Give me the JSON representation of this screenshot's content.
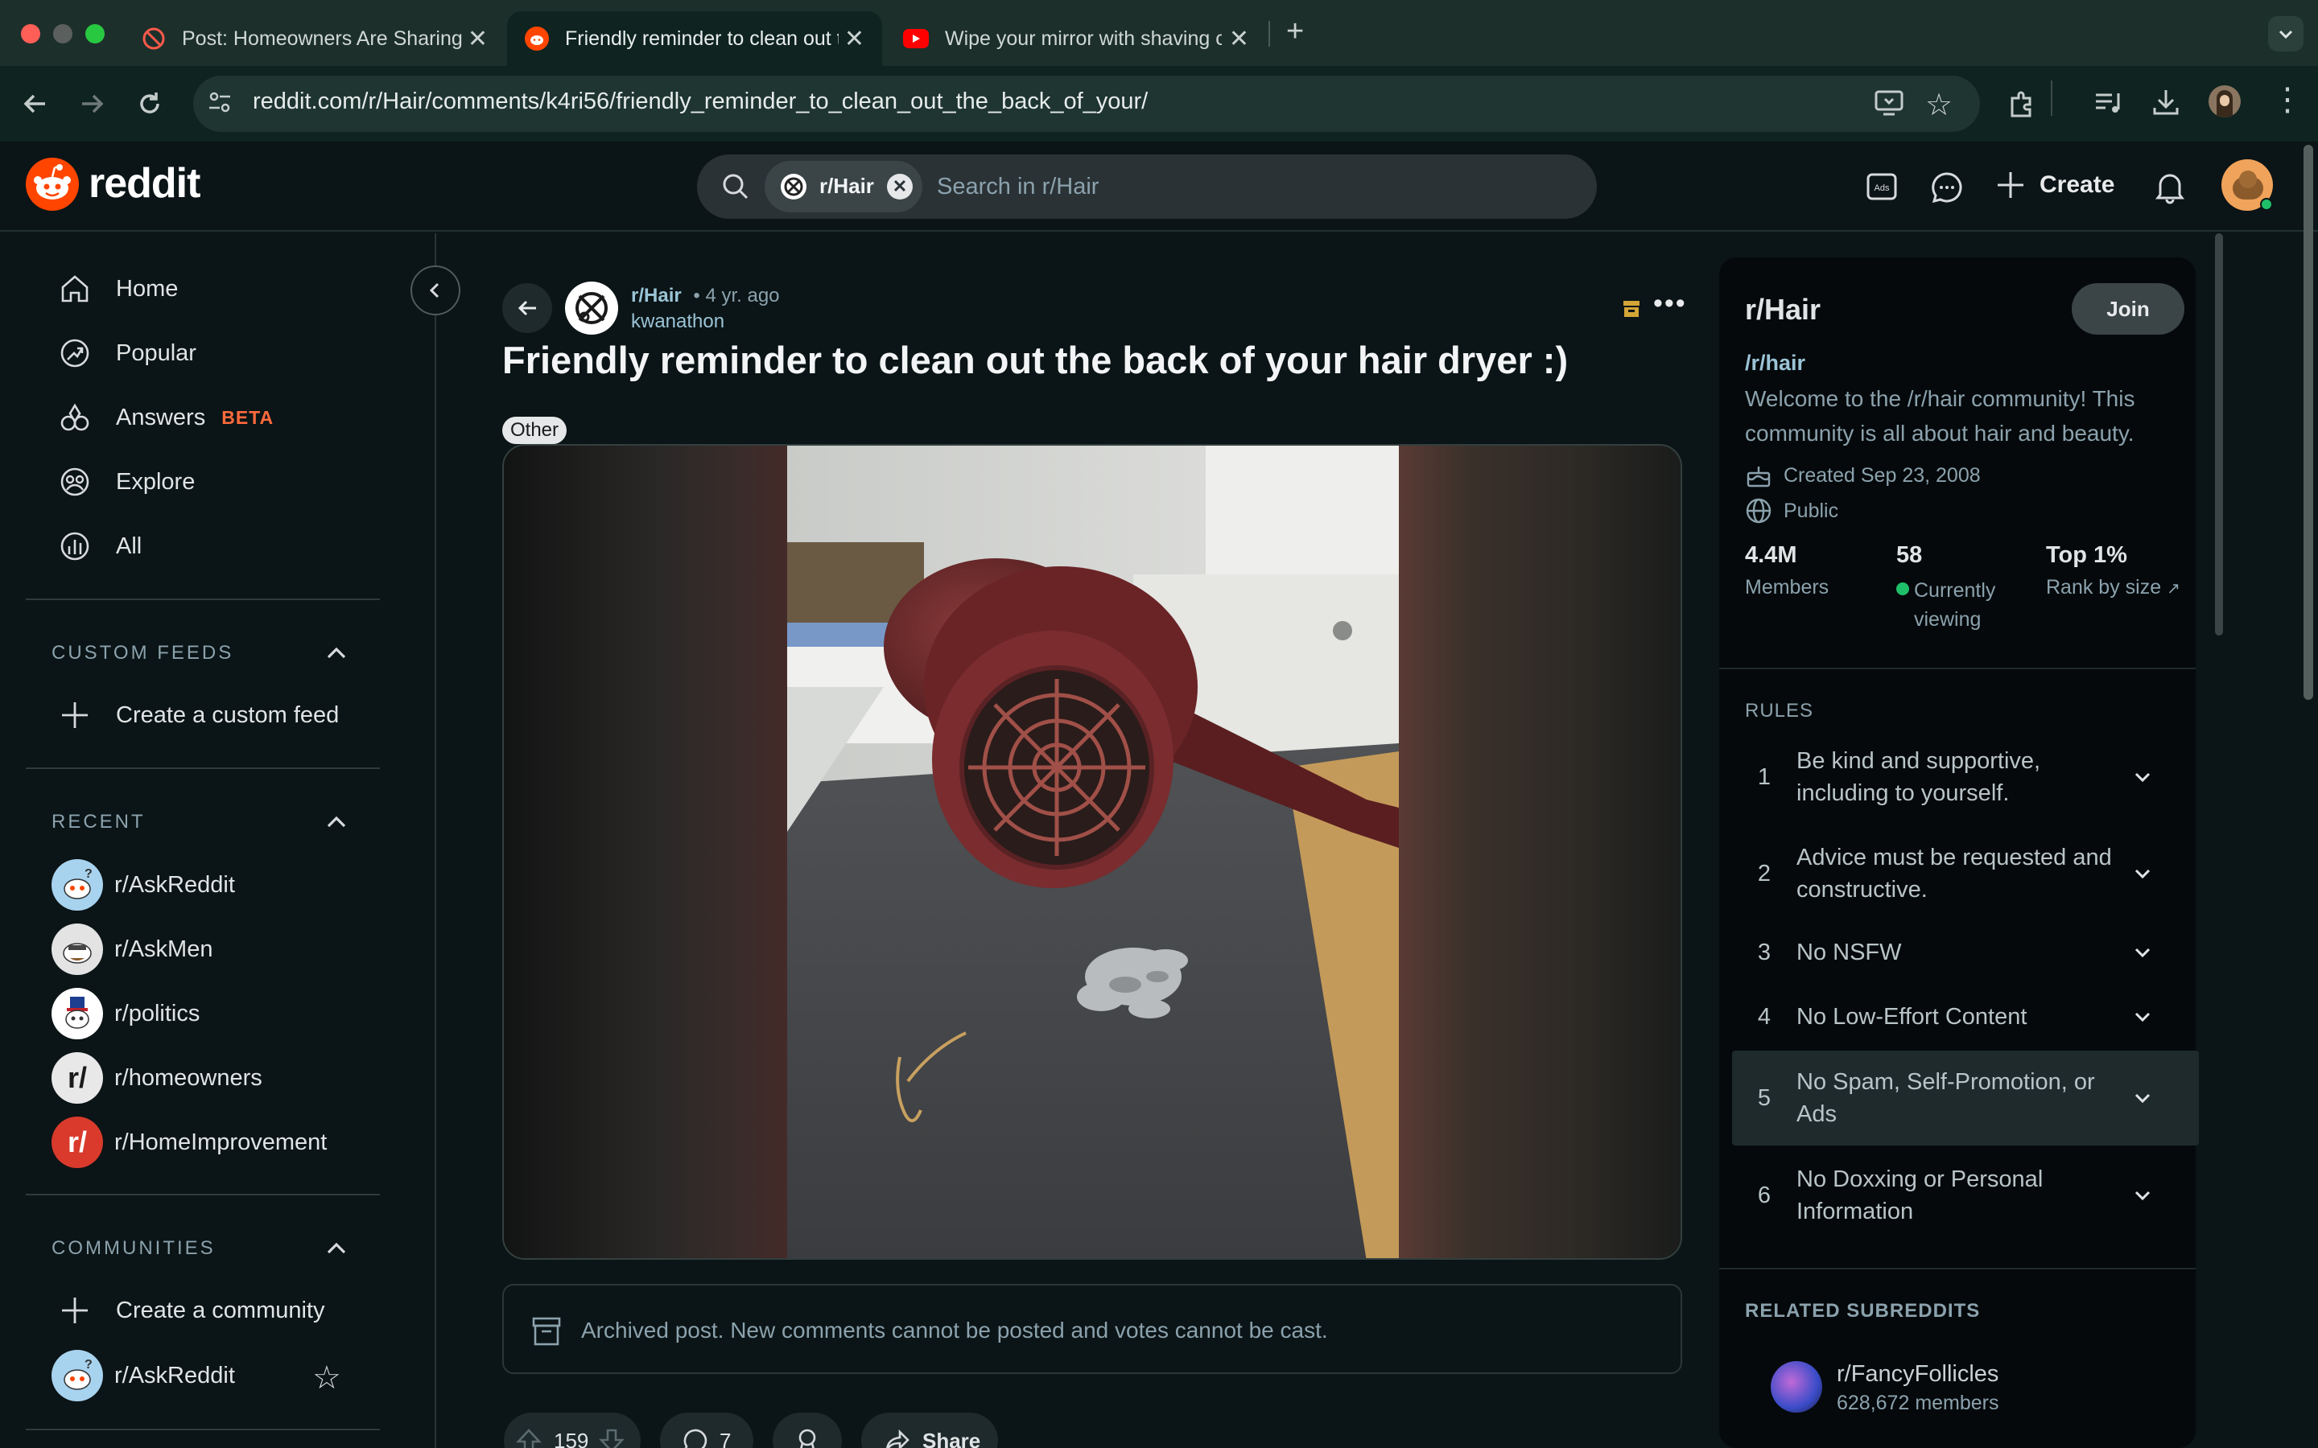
{
  "browser": {
    "tabs": [
      {
        "title": "Post: Homeowners Are Sharing",
        "icon": "blocked-icon"
      },
      {
        "title": "Friendly reminder to clean out the back of your hair dryer",
        "icon": "reddit-icon",
        "active": true
      },
      {
        "title": "Wipe your mirror with shaving cream",
        "icon": "youtube-icon"
      }
    ],
    "url": "reddit.com/r/Hair/comments/k4ri56/friendly_reminder_to_clean_out_the_back_of_your/"
  },
  "header": {
    "logo_text": "reddit",
    "search_chip": "r/Hair",
    "search_placeholder": "Search in r/Hair",
    "create_label": "Create"
  },
  "left_nav": {
    "main": [
      {
        "label": "Home",
        "icon": "home-icon"
      },
      {
        "label": "Popular",
        "icon": "popular-icon"
      },
      {
        "label": "Answers",
        "badge": "BETA",
        "icon": "answers-icon"
      },
      {
        "label": "Explore",
        "icon": "explore-icon"
      },
      {
        "label": "All",
        "icon": "all-icon"
      }
    ],
    "custom_feeds": {
      "heading": "CUSTOM FEEDS",
      "create": "Create a custom feed"
    },
    "recent": {
      "heading": "RECENT",
      "items": [
        "r/AskReddit",
        "r/AskMen",
        "r/politics",
        "r/homeowners",
        "r/HomeImprovement"
      ]
    },
    "communities": {
      "heading": "COMMUNITIES",
      "create": "Create a community",
      "items": [
        "r/AskReddit"
      ]
    }
  },
  "post": {
    "subreddit": "r/Hair",
    "age": "• 4 yr. ago",
    "author": "kwanathon",
    "title": "Friendly reminder to clean out the back of your hair dryer :)",
    "flair": "Other",
    "archived_notice": "Archived post. New comments cannot be posted and votes cannot be cast.",
    "votes": "159",
    "comments": "7",
    "share_label": "Share"
  },
  "sidebar": {
    "name": "r/Hair",
    "join_label": "Join",
    "handle": "/r/hair",
    "description": "Welcome to the /r/hair community! This community is all about hair and beauty.",
    "created": "Created Sep 23, 2008",
    "visibility": "Public",
    "stats": [
      {
        "value": "4.4M",
        "label": "Members"
      },
      {
        "value": "58",
        "label": "Currently viewing"
      },
      {
        "value": "Top 1%",
        "label": "Rank by size"
      }
    ],
    "rules_heading": "RULES",
    "rules": [
      {
        "num": "1",
        "text": "Be kind and supportive, including to yourself."
      },
      {
        "num": "2",
        "text": "Advice must be requested and constructive."
      },
      {
        "num": "3",
        "text": "No NSFW"
      },
      {
        "num": "4",
        "text": "No Low-Effort Content"
      },
      {
        "num": "5",
        "text": "No Spam, Self-Promotion, or Ads"
      },
      {
        "num": "6",
        "text": "No Doxxing or Personal Information"
      }
    ],
    "related_heading": "RELATED SUBREDDITS",
    "related": [
      {
        "name": "r/FancyFollicles",
        "members": "628,672 members"
      }
    ]
  },
  "colors": {
    "accent_orange": "#ff4500",
    "beta_orange": "#ff6a3d",
    "online_green": "#1fbf6a",
    "link_blue": "#9ac4d6"
  }
}
